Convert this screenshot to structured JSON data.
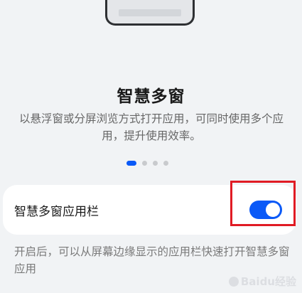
{
  "feature": {
    "title": "智慧多窗",
    "description": "以悬浮窗或分屏浏览方式打开应用，可同时使用多个应用，提升使用效率。"
  },
  "pager": {
    "total": 4,
    "active_index": 0
  },
  "setting": {
    "label": "智慧多窗应用栏",
    "enabled": true,
    "toggle_color": "#0a59f7"
  },
  "helper_text": "开启后，可以从屏幕边缘显示的应用栏快速打开智慧多窗应用",
  "watermark": {
    "text": "Baidu经验"
  },
  "colors": {
    "accent": "#0a59f7",
    "highlight_frame": "#e01b24",
    "background": "#f1f3f5"
  }
}
